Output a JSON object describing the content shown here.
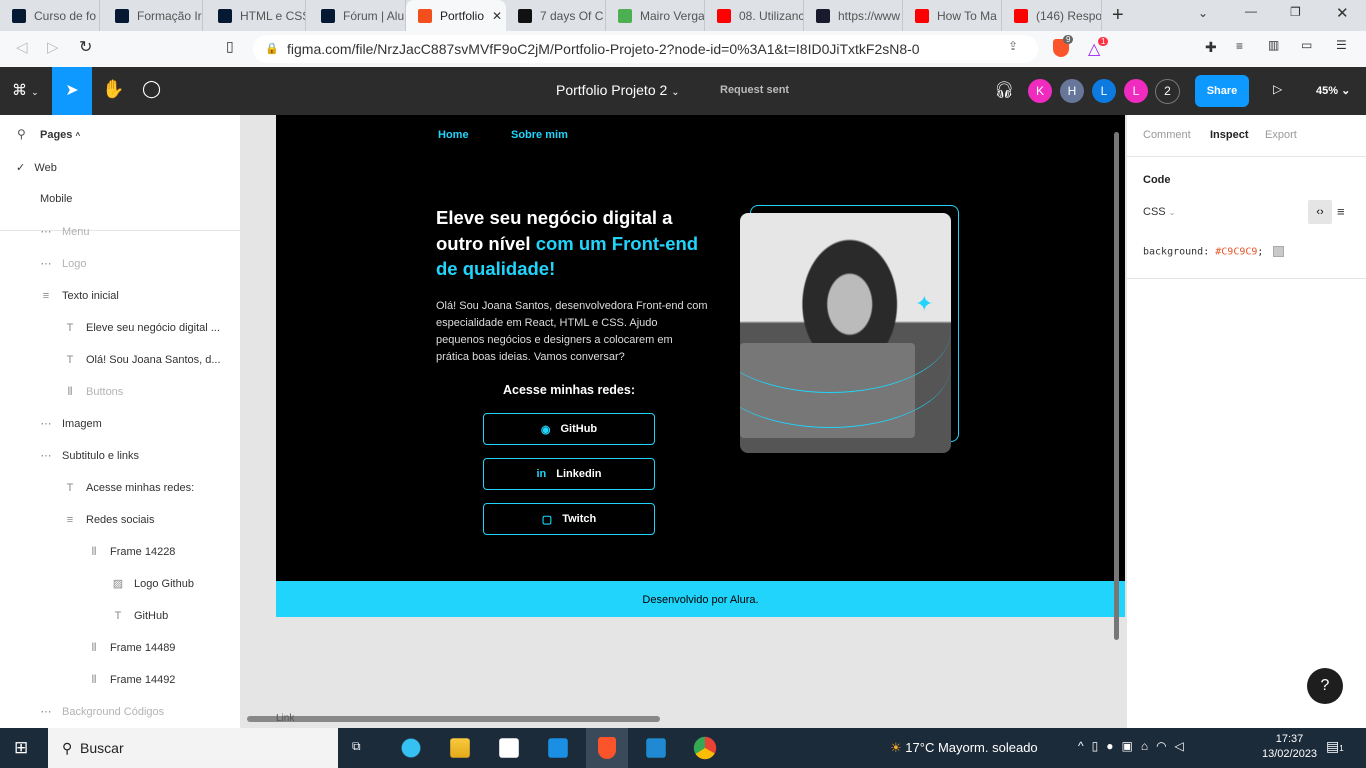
{
  "browser": {
    "tabs": [
      {
        "title": "Curso de fo",
        "icon": "alura-icon",
        "color": "#051933"
      },
      {
        "title": "Formação Ir",
        "icon": "alura-icon",
        "color": "#051933"
      },
      {
        "title": "HTML e CSS",
        "icon": "alura-icon",
        "color": "#051933"
      },
      {
        "title": "Fórum | Alu",
        "icon": "alura-icon",
        "color": "#051933"
      },
      {
        "title": "Portfolio",
        "icon": "figma-icon",
        "color": "#f24e1e",
        "active": true
      },
      {
        "title": "7 days Of C",
        "icon": "question-icon",
        "color": "#111"
      },
      {
        "title": "Mairo Verga",
        "icon": "chat-icon",
        "color": "#4caf50"
      },
      {
        "title": "08. Utilizanc",
        "icon": "youtube-icon",
        "color": "#ff0000"
      },
      {
        "title": "https://www",
        "icon": "site-icon",
        "color": "#1a1a2e"
      },
      {
        "title": "How To Ma",
        "icon": "youtube-icon",
        "color": "#ff0000"
      },
      {
        "title": "(146) Respo",
        "icon": "youtube-icon",
        "color": "#ff0000"
      }
    ],
    "url": "figma.com/file/NrzJacC887svMVfF9oC2jM/Portfolio-Projeto-2?node-id=0%3A1&t=I8ID0JiTxtkF2sN8-0",
    "brave_badge": "9",
    "rewards_badge": "1"
  },
  "figma": {
    "file_title": "Portfolio Projeto 2",
    "status": "Request sent",
    "avatars": [
      {
        "l": "K",
        "c": "#f02bbf"
      },
      {
        "l": "H",
        "c": "#667799"
      },
      {
        "l": "L",
        "c": "#0d7ae0"
      },
      {
        "l": "L",
        "c": "#f02bbf"
      }
    ],
    "extra_count": "2",
    "share": "Share",
    "zoom": "45%",
    "accent": "#0d99ff"
  },
  "left_panel": {
    "pages_label": "Pages",
    "pages": [
      "Web",
      "Mobile"
    ],
    "layers": [
      {
        "n": "Menu",
        "i": "frame",
        "lvl": 1,
        "dim": true
      },
      {
        "n": "Logo",
        "i": "frame",
        "lvl": 1,
        "dim": true
      },
      {
        "n": "Texto inicial",
        "i": "autolayout",
        "lvl": 1
      },
      {
        "n": "Eleve seu negócio digital ...",
        "i": "text",
        "lvl": 2
      },
      {
        "n": "Olá! Sou Joana Santos, d...",
        "i": "text",
        "lvl": 2
      },
      {
        "n": "Buttons",
        "i": "columns",
        "lvl": 2,
        "dim": true
      },
      {
        "n": "Imagem",
        "i": "frame",
        "lvl": 1
      },
      {
        "n": "Subtitulo e links",
        "i": "frame",
        "lvl": 1
      },
      {
        "n": "Acesse minhas redes:",
        "i": "text",
        "lvl": 2
      },
      {
        "n": "Redes sociais",
        "i": "autolayout",
        "lvl": 2
      },
      {
        "n": "Frame 14228",
        "i": "columns",
        "lvl": 3
      },
      {
        "n": "Logo Github",
        "i": "image",
        "lvl": 4
      },
      {
        "n": "GitHub",
        "i": "text",
        "lvl": 4
      },
      {
        "n": "Frame 14489",
        "i": "columns",
        "lvl": 3
      },
      {
        "n": "Frame 14492",
        "i": "columns",
        "lvl": 3
      },
      {
        "n": "Background Códigos",
        "i": "frame",
        "lvl": 1,
        "dim": true
      }
    ]
  },
  "canvas": {
    "nav": [
      "Home",
      "Sobre mim"
    ],
    "headline_white": "Eleve seu negócio digital a outro nível",
    "headline_cyan": "com um Front-end de qualidade!",
    "intro": "Olá! Sou Joana Santos, desenvolvedora Front-end com especialidade em React, HTML e CSS. Ajudo pequenos negócios e designers a colocarem em prática boas ideias. Vamos conversar?",
    "social_title": "Acesse minhas redes:",
    "social": [
      {
        "label": "GitHub",
        "icon": "github-icon"
      },
      {
        "label": "Linkedin",
        "icon": "linkedin-icon"
      },
      {
        "label": "Twitch",
        "icon": "twitch-icon"
      }
    ],
    "footer": "Desenvolvido por Alura.",
    "bottom_label": "Link",
    "accent": "#20d4fb"
  },
  "right_panel": {
    "tabs": [
      "Comment",
      "Inspect",
      "Export"
    ],
    "active_tab": "Inspect",
    "code_label": "Code",
    "lang": "CSS",
    "css_prop": "background:",
    "css_value": "#C9C9C9",
    "css_end": ";"
  },
  "taskbar": {
    "search": "Buscar",
    "weather": "17°C  Mayorm. soleado",
    "time": "17:37",
    "date": "13/02/2023",
    "notif": "1"
  }
}
